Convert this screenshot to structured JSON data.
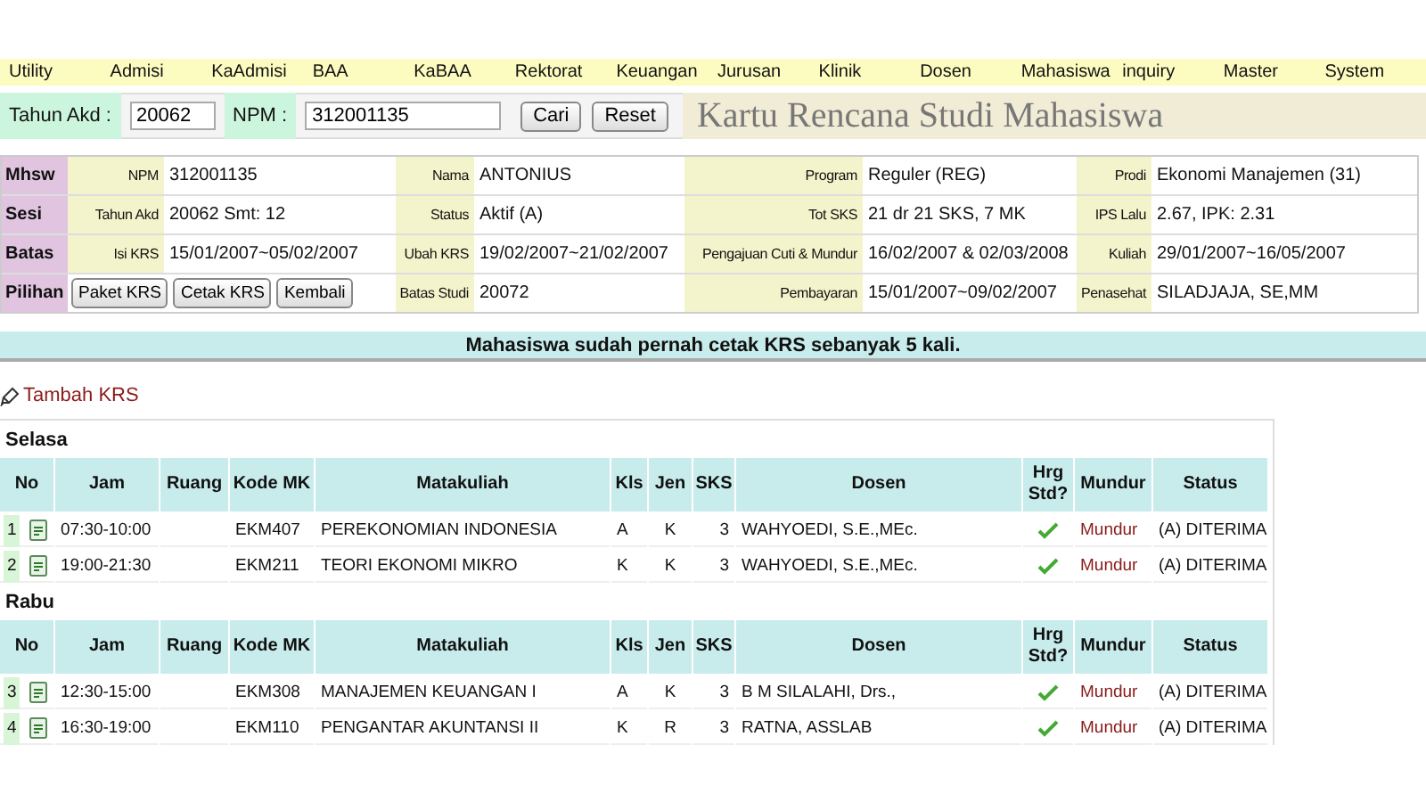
{
  "menu": [
    "Utility",
    "Admisi",
    "KaAdmisi",
    "BAA",
    "KaBAA",
    "Rektorat",
    "Keuangan",
    "Jurusan",
    "Klinik",
    "Dosen",
    "Mahasiswa",
    "inquiry",
    "Master",
    "System"
  ],
  "search": {
    "fields": [
      {
        "label": "Tahun Akd :",
        "value": "20062"
      },
      {
        "label": "NPM :",
        "value": "312001135"
      }
    ],
    "buttons": [
      "Cari",
      "Reset"
    ],
    "title": "Kartu Rencana Studi Mahasiswa"
  },
  "info": [
    {
      "label": "Mhsw",
      "fields": [
        {
          "label": "NPM",
          "value": "312001135"
        },
        {
          "label": "Nama",
          "value": "ANTONIUS"
        },
        {
          "label": "Program",
          "value": "Reguler (REG)"
        },
        {
          "label": "Prodi",
          "value": "Ekonomi Manajemen (31)"
        }
      ]
    },
    {
      "label": "Sesi",
      "fields": [
        {
          "label": "Tahun Akd",
          "value": "20062 Smt: 12"
        },
        {
          "label": "Status",
          "value": "Aktif (A)"
        },
        {
          "label": "Tot SKS",
          "value": "21 dr 21 SKS, 7 MK"
        },
        {
          "label": "IPS Lalu",
          "value": "2.67, IPK: 2.31"
        }
      ]
    },
    {
      "label": "Batas",
      "fields": [
        {
          "label": "Isi KRS",
          "value": "15/01/2007~05/02/2007"
        },
        {
          "label": "Ubah KRS",
          "value": "19/02/2007~21/02/2007"
        },
        {
          "label": "Pengajuan Cuti & Mundur",
          "value": "16/02/2007 & 02/03/2008"
        },
        {
          "label": "Kuliah",
          "value": "29/01/2007~16/05/2007"
        }
      ]
    },
    {
      "label": "Pilihan",
      "buttons": [
        "Paket KRS",
        "Cetak KRS",
        "Kembali"
      ],
      "fields": [
        {
          "label": "Batas Studi",
          "value": "20072"
        },
        {
          "label": "Pembayaran",
          "value": "15/01/2007~09/02/2007"
        },
        {
          "label": "Penasehat",
          "value": "SILADJAJA, SE,MM"
        }
      ]
    }
  ],
  "message": "Mahasiswa sudah pernah cetak KRS sebanyak 5 kali.",
  "add_link": "Tambah KRS",
  "days": [
    {
      "day": "Selasa",
      "columns": [
        "No",
        "Jam",
        "Ruang",
        "Kode MK",
        "Matakuliah",
        "Kls",
        "Jen",
        "SKS",
        "Dosen",
        "Hrg Std?",
        "Mundur",
        "Status"
      ],
      "rows": [
        {
          "no": "1",
          "jam": "07:30-10:00",
          "kode": "EKM407",
          "matakuliah": "PEREKONOMIAN INDONESIA",
          "kls": "A",
          "jen": "K",
          "sks": "3",
          "dosen": "WAHYOEDI, S.E.,MEc.",
          "hrg_std": true,
          "mundur": "Mundur",
          "status": "(A) DITERIMA"
        },
        {
          "no": "2",
          "jam": "19:00-21:30",
          "kode": "EKM211",
          "matakuliah": "TEORI EKONOMI MIKRO",
          "kls": "K",
          "jen": "K",
          "sks": "3",
          "dosen": "WAHYOEDI, S.E.,MEc.",
          "hrg_std": true,
          "mundur": "Mundur",
          "status": "(A) DITERIMA"
        }
      ]
    },
    {
      "day": "Rabu",
      "columns": [
        "No",
        "Jam",
        "Ruang",
        "Kode MK",
        "Matakuliah",
        "Kls",
        "Jen",
        "SKS",
        "Dosen",
        "Hrg Std?",
        "Mundur",
        "Status"
      ],
      "rows": [
        {
          "no": "3",
          "jam": "12:30-15:00",
          "kode": "EKM308",
          "matakuliah": "MANAJEMEN KEUANGAN I",
          "kls": "A",
          "jen": "K",
          "sks": "3",
          "dosen": "B M SILALAHI, Drs.,",
          "hrg_std": true,
          "mundur": "Mundur",
          "status": "(A) DITERIMA"
        },
        {
          "no": "4",
          "jam": "16:30-19:00",
          "kode": "EKM110",
          "matakuliah": "PENGANTAR AKUNTANSI II",
          "kls": "K",
          "jen": "R",
          "sks": "3",
          "dosen": "RATNA, ASSLAB",
          "hrg_std": true,
          "mundur": "Mundur",
          "status": "(A) DITERIMA"
        }
      ]
    }
  ]
}
